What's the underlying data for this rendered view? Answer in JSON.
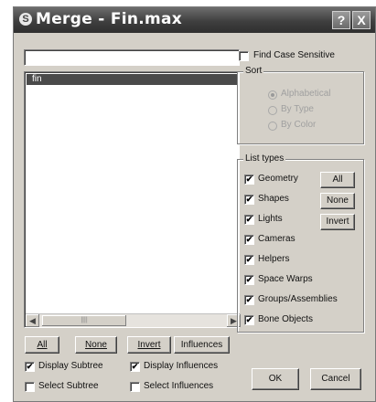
{
  "window": {
    "title": "Merge - Fin.max",
    "help_label": "?",
    "close_label": "X"
  },
  "filter_input": {
    "value": ""
  },
  "object_list": {
    "items": [
      "fin"
    ],
    "selected_index": 0,
    "scroll_thumb_grip": "||||"
  },
  "list_buttons": {
    "all": "All",
    "none": "None",
    "invert": "Invert",
    "influences": "Influences"
  },
  "display_subtree": {
    "label": "Display Subtree",
    "checked": true
  },
  "select_subtree": {
    "label": "Select Subtree",
    "checked": false
  },
  "display_influences": {
    "label": "Display Influences",
    "checked": true
  },
  "select_influences": {
    "label": "Select Influences",
    "checked": false
  },
  "find_case_sensitive": {
    "label": "Find Case Sensitive",
    "checked": false
  },
  "sort": {
    "legend": "Sort",
    "options": [
      "Alphabetical",
      "By Type",
      "By Color"
    ],
    "selected": "Alphabetical",
    "enabled": false
  },
  "list_types": {
    "legend": "List types",
    "items": [
      {
        "label": "Geometry",
        "checked": true
      },
      {
        "label": "Shapes",
        "checked": true
      },
      {
        "label": "Lights",
        "checked": true
      },
      {
        "label": "Cameras",
        "checked": true
      },
      {
        "label": "Helpers",
        "checked": true
      },
      {
        "label": "Space Warps",
        "checked": true
      },
      {
        "label": "Groups/Assemblies",
        "checked": true
      },
      {
        "label": "Bone Objects",
        "checked": true
      }
    ],
    "all_label": "All",
    "none_label": "None",
    "invert_label": "Invert"
  },
  "dialog_buttons": {
    "ok": "OK",
    "cancel": "Cancel"
  },
  "check_glyph": "✔"
}
